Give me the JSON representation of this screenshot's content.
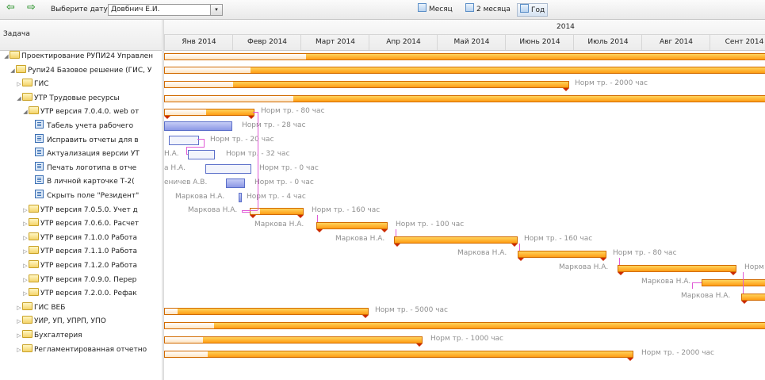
{
  "toolbar": {
    "date_label": "Выберите дату",
    "date_caret": "▾",
    "user_value": "Довбнич Е.И.",
    "combo_caret": "▾",
    "back_arrow": "⇦",
    "forward_arrow": "⇨",
    "view_month": "Месяц",
    "view_2months": "2 месяца",
    "view_year": "Год"
  },
  "columns": {
    "task_header": "Задача"
  },
  "timeline": {
    "year": "2014",
    "months": [
      "Янв 2014",
      "Февр 2014",
      "Март 2014",
      "Апр 2014",
      "Май 2014",
      "Июнь 2014",
      "Июль 2014",
      "Авг 2014",
      "Сент 2014"
    ]
  },
  "tasks": [
    {
      "label": "Проектирование РУПИ24 Управлен",
      "indent": 0,
      "toggle": "◢",
      "icon": "folder-icon"
    },
    {
      "label": "Рупи24 Базовое решение (ГИС, У",
      "indent": 1,
      "toggle": "◢",
      "icon": "folder-icon"
    },
    {
      "label": "ГИС",
      "indent": 2,
      "toggle": "▷",
      "icon": "folder-icon"
    },
    {
      "label": "УТР Трудовые ресурсы",
      "indent": 2,
      "toggle": "◢",
      "icon": "folder-icon"
    },
    {
      "label": "УТР версия 7.0.4.0. web от",
      "indent": 3,
      "toggle": "◢",
      "icon": "folder-icon"
    },
    {
      "label": "Табель учета рабочего",
      "indent": 4,
      "toggle": "",
      "icon": "task-icon"
    },
    {
      "label": "Исправить отчеты для в",
      "indent": 4,
      "toggle": "",
      "icon": "task-icon"
    },
    {
      "label": "Актуализация версии УТ",
      "indent": 4,
      "toggle": "",
      "icon": "task-icon"
    },
    {
      "label": "Печать логотипа в отче",
      "indent": 4,
      "toggle": "",
      "icon": "task-icon"
    },
    {
      "label": "В личной карточке Т-2(",
      "indent": 4,
      "toggle": "",
      "icon": "task-icon"
    },
    {
      "label": "Скрыть поле \"Резидент\"",
      "indent": 4,
      "toggle": "",
      "icon": "task-icon"
    },
    {
      "label": "УТР версия 7.0.5.0. Учет д",
      "indent": 3,
      "toggle": "▷",
      "icon": "folder-icon"
    },
    {
      "label": "УТР версия 7.0.6.0. Расчет",
      "indent": 3,
      "toggle": "▷",
      "icon": "folder-icon"
    },
    {
      "label": "УТР версия 7.1.0.0 Работа",
      "indent": 3,
      "toggle": "▷",
      "icon": "folder-icon"
    },
    {
      "label": "УТР версия 7.1.1.0 Работа",
      "indent": 3,
      "toggle": "▷",
      "icon": "folder-icon"
    },
    {
      "label": "УТР версия 7.1.2.0 Работа",
      "indent": 3,
      "toggle": "▷",
      "icon": "folder-icon"
    },
    {
      "label": "УТР версия 7.0.9.0. Перер",
      "indent": 3,
      "toggle": "▷",
      "icon": "folder-icon"
    },
    {
      "label": "УТР версия 7.2.0.0. Рефак",
      "indent": 3,
      "toggle": "▷",
      "icon": "folder-icon"
    },
    {
      "label": "ГИС ВЕБ",
      "indent": 2,
      "toggle": "▷",
      "icon": "folder-icon"
    },
    {
      "label": "УИР, УП, УПРП, УПО",
      "indent": 2,
      "toggle": "▷",
      "icon": "folder-icon"
    },
    {
      "label": "Бухгалтерия",
      "indent": 2,
      "toggle": "▷",
      "icon": "folder-icon"
    },
    {
      "label": "Регламентированная отчетно",
      "indent": 2,
      "toggle": "▷",
      "icon": "folder-icon"
    }
  ],
  "gantt": {
    "labels": {
      "gis": "Норм тр. - 2000 час",
      "v7040": "Норм тр. - 80 час",
      "t1": "Норм тр. - 28 час",
      "t2": "Норм тр. - 20 час",
      "t3_left": "Н.А.",
      "t3": "Норм тр. - 32 час",
      "t4_left": "а Н.А.",
      "t4": "Норм тр. - 0 час",
      "t5_left": "еничев А.В.",
      "t5": "Норм тр. - 0 час",
      "t6_left": "Маркова Н.А.",
      "t6": "Норм тр. - 4 час",
      "v7050_left": "Маркова Н.А.",
      "v7050": "Норм тр. - 160 час",
      "v7060_left": "Маркова Н.А.",
      "v7060": "Норм тр. - 100 час",
      "v7100_left": "Маркова Н.А.",
      "v7100": "Норм тр. - 160 час",
      "v7110_left": "Маркова Н.А.",
      "v7110": "Норм тр. - 80 час",
      "v7120_left": "Маркова Н.А.",
      "v7120": "Норм т",
      "v7090_left": "Маркова Н.А.",
      "v7200_left": "Маркова Н.А.",
      "gisweb": "Норм тр. - 5000 час",
      "buh": "Норм тр. - 1000 час",
      "reg": "Норм тр. - 2000 час"
    }
  },
  "colors": {
    "summary_bar": "#ff9d14",
    "summary_border": "#d26b00",
    "task_bar": "#8b98e5",
    "connector": "#e05ad6",
    "milestone_marker": "#cc2b00"
  }
}
